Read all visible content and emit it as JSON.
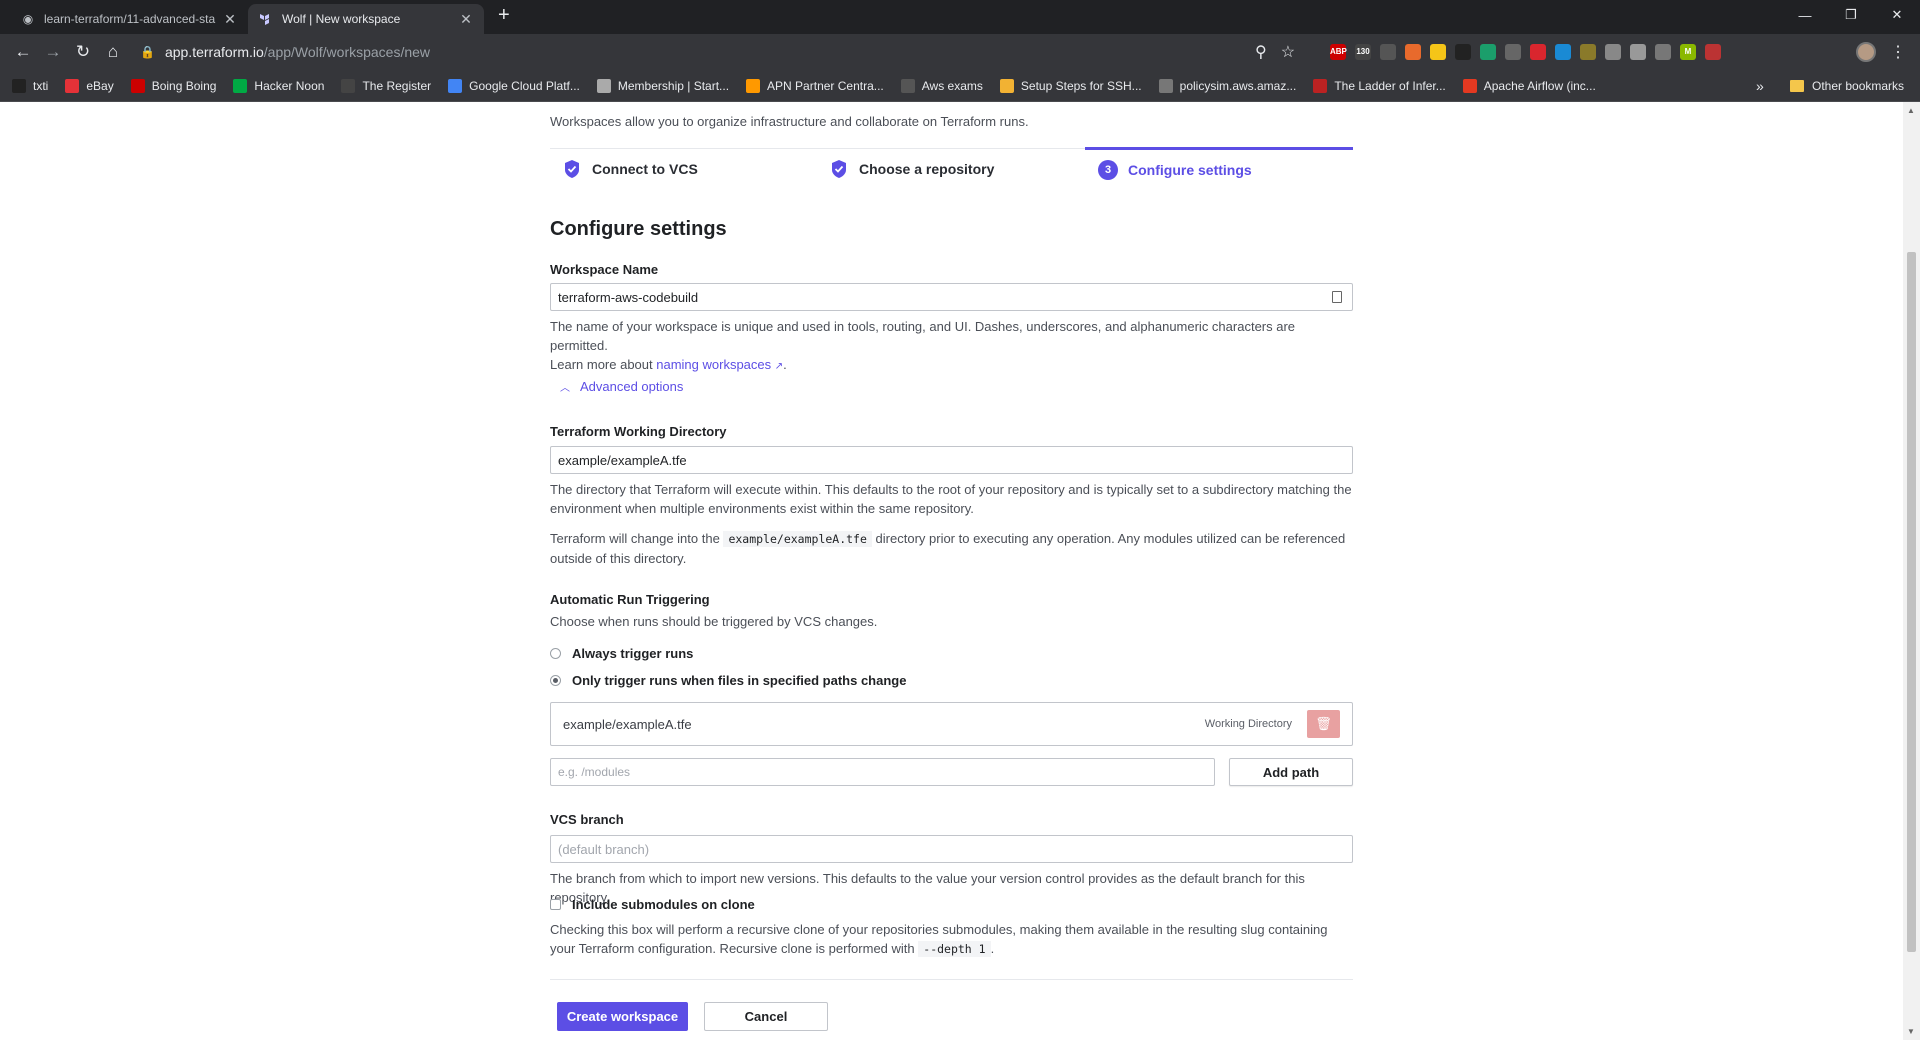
{
  "browser": {
    "tabs": [
      {
        "title": "learn-terraform/11-advanced-sta",
        "active": false
      },
      {
        "title": "Wolf | New workspace",
        "active": true
      }
    ],
    "url_host": "app.terraform.io",
    "url_path": "/app/Wolf/workspaces/new",
    "bookmarks": [
      {
        "label": "txti",
        "icon": "txti-icon",
        "color": "#222"
      },
      {
        "label": "eBay",
        "icon": "ebay-icon",
        "color": "#e53238"
      },
      {
        "label": "Boing Boing",
        "icon": "bb-icon",
        "color": "#cc0000"
      },
      {
        "label": "Hacker Noon",
        "icon": "hn-icon",
        "color": "#00aa44"
      },
      {
        "label": "The Register",
        "icon": "register-icon",
        "color": "#444"
      },
      {
        "label": "Google Cloud Platf...",
        "icon": "gcp-icon",
        "color": "#4285f4"
      },
      {
        "label": "Membership | Start...",
        "icon": "cloud-icon",
        "color": "#aaa"
      },
      {
        "label": "APN Partner Centra...",
        "icon": "apn-icon",
        "color": "#ff9900"
      },
      {
        "label": "Aws exams",
        "icon": "aws-exams-icon",
        "color": "#555"
      },
      {
        "label": "Setup Steps for SSH...",
        "icon": "box-icon",
        "color": "#f2b233"
      },
      {
        "label": "policysim.aws.amaz...",
        "icon": "globe-icon",
        "color": "#777"
      },
      {
        "label": "The Ladder of Infer...",
        "icon": "ladder-icon",
        "color": "#b22"
      },
      {
        "label": "Apache Airflow (inc...",
        "icon": "airflow-icon",
        "color": "#e43921"
      }
    ],
    "other_bookmarks": "Other bookmarks",
    "more": "»"
  },
  "page": {
    "intro": "Workspaces allow you to organize infrastructure and collaborate on Terraform runs.",
    "steps": [
      {
        "label": "Connect to VCS",
        "state": "done"
      },
      {
        "label": "Choose a repository",
        "state": "done"
      },
      {
        "label": "Configure settings",
        "state": "current",
        "number": "3"
      }
    ],
    "heading": "Configure settings",
    "workspace_name": {
      "label": "Workspace Name",
      "value": "terraform-aws-codebuild",
      "help_prefix": "The name of your workspace is unique and used in tools, routing, and UI. Dashes, underscores, and alphanumeric characters are permitted.",
      "help_learn": "Learn more about",
      "help_link": "naming workspaces",
      "help_suffix": "."
    },
    "advanced_options": "Advanced options",
    "working_directory": {
      "label": "Terraform Working Directory",
      "value": "example/exampleA.tfe",
      "help1": "The directory that Terraform will execute within. This defaults to the root of your repository and is typically set to a subdirectory matching the environment when multiple environments exist within the same repository.",
      "help2_prefix": "Terraform will change into the",
      "help2_code": "example/exampleA.tfe",
      "help2_suffix": "directory prior to executing any operation. Any modules utilized can be referenced outside of this directory."
    },
    "run_triggering": {
      "label": "Automatic Run Triggering",
      "help": "Choose when runs should be triggered by VCS changes.",
      "option_always": "Always trigger runs",
      "option_paths": "Only trigger runs when files in specified paths change",
      "selected": "paths",
      "path_entry": "example/exampleA.tfe",
      "path_tag": "Working Directory",
      "path_placeholder": "e.g. /modules",
      "add_path": "Add path"
    },
    "vcs_branch": {
      "label": "VCS branch",
      "placeholder": "(default branch)",
      "help": "The branch from which to import new versions. This defaults to the value your version control provides as the default branch for this repository."
    },
    "submodules": {
      "label": "Include submodules on clone",
      "checked": false,
      "help_prefix": "Checking this box will perform a recursive clone of your repositories submodules, making them available in the resulting slug containing your Terraform configuration. Recursive clone is performed with",
      "help_code": "--depth 1",
      "help_suffix": "."
    },
    "create_button": "Create workspace",
    "cancel_button": "Cancel"
  },
  "colors": {
    "accent": "#5c4ee5",
    "delete": "#e8a1a1"
  }
}
